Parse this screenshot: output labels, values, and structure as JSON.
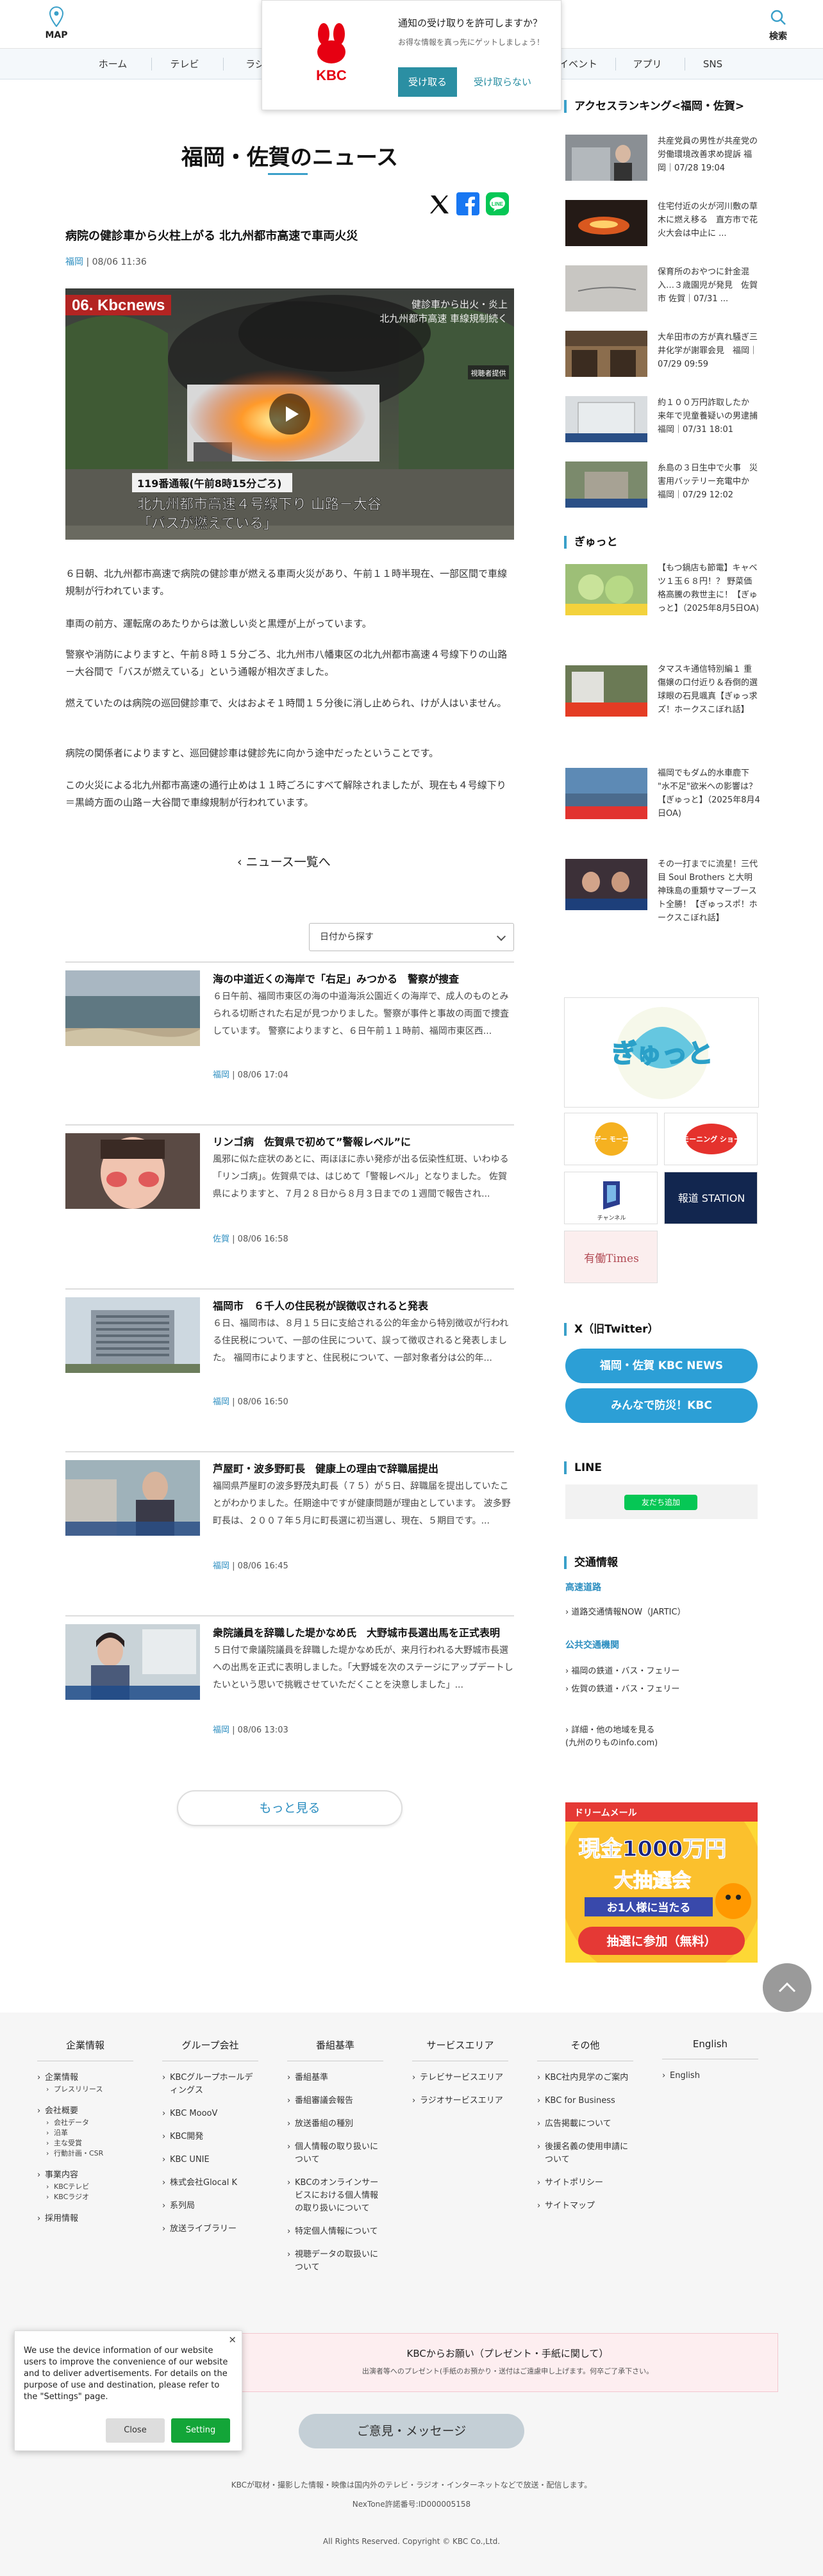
{
  "header": {
    "map_label": "MAP",
    "search_label": "検索"
  },
  "nav": {
    "items": [
      "ホーム",
      "テレビ",
      "ラジ",
      "イベント",
      "アプリ",
      "SNS"
    ]
  },
  "notification": {
    "logo_text": "KBC",
    "title": "通知の受け取りを許可しますか？",
    "subtitle": "お得な情報を真っ先にゲットしましょう！",
    "accept": "受け取る",
    "decline": "受け取らない"
  },
  "page": {
    "title": "福岡・佐賀のニュース"
  },
  "article": {
    "title": "病院の健診車から火柱上がる 北九州都市高速で車両火災",
    "category": "福岡",
    "date": "08/06 11:36",
    "video": {
      "logo": "06. Kbcnews",
      "topright1": "健診車から出火・炎上",
      "topright2": "北九州都市高速 車線規制続く",
      "badge": "視聴者提供",
      "caption_top": "119番通報(午前8時15分ごろ)",
      "caption_line1": "北九州都市高速４号線下り 山路－大谷",
      "caption_line2": "「バスが燃えている」"
    },
    "paragraphs": [
      "６日朝、北九州都市高速で病院の健診車が燃える車両火災があり、午前１１時半現在、一部区間で車線規制が行われています。",
      "車両の前方、運転席のあたりからは激しい炎と黒煙が上がっています。",
      "警察や消防によりますと、午前８時１５分ごろ、北九州市八幡東区の北九州都市高速４号線下りの山路－大谷間で「バスが燃えている」という通報が相次ぎました。",
      "燃えていたのは病院の巡回健診車で、火はおよそ１時間１５分後に消し止められ、けが人はいません。",
      "病院の関係者によりますと、巡回健診車は健診先に向かう途中だったということです。",
      "この火災による北九州都市高速の通行止めは１１時ごろにすべて解除されましたが、現在も４号線下り＝黒崎方面の山路－大谷間で車線規制が行われています。"
    ]
  },
  "back_link": "ニュース一覧へ",
  "sort": {
    "selected": "日付から探す"
  },
  "news": [
    {
      "title": "海の中道近くの海岸で「右足」みつかる　警察が捜査",
      "body": "６日午前、福岡市東区の海の中道海浜公園近くの海岸で、成人のものとみられる切断された右足が見つかりました。警察が事件と事故の両面で捜査しています。 警察によりますと、６日午前１１時前、福岡市東区西...",
      "category": "福岡",
      "date": "08/06 17:04"
    },
    {
      "title": "リンゴ病　佐賀県で初めて”警報レベル”に",
      "body": "風邪に似た症状のあとに、両ほほに赤い発疹が出る伝染性紅斑、いわゆる「リンゴ病」。佐賀県では、はじめて「警報レベル」となりました。 佐賀県によりますと、７月２８日から８月３日までの１週間で報告され...",
      "category": "佐賀",
      "date": "08/06 16:58"
    },
    {
      "title": "福岡市　６千人の住民税が誤徴収されると発表",
      "body": "６日、福岡市は、８月１５日に支給される公的年金から特別徴収が行われる住民税について、一部の住民について、誤って徴収されると発表しました。 福岡市によりますと、住民税について、一部対象者分は公的年...",
      "category": "福岡",
      "date": "08/06 16:50"
    },
    {
      "title": "芦屋町・波多野町長　健康上の理由で辞職届提出",
      "body": "福岡県芦屋町の波多野茂丸町長（７５）が５日、辞職届を提出していたことがわかりました。任期途中ですが健康問題が理由としています。 波多野町長は、２００７年５月に町長選に初当選し、現在、５期目です。...",
      "category": "福岡",
      "date": "08/06 16:45"
    },
    {
      "title": "衆院議員を辞職した堤かなめ氏　大野城市長選出馬を正式表明",
      "body": "５日付で衆議院議員を辞職した堤かなめ氏が、来月行われる大野城市長選への出馬を正式に表明しました。「大野城を次のステージにアップデートしたいという思いで挑戦させていただくことを決意しました」...",
      "category": "福岡",
      "date": "08/06 13:03"
    }
  ],
  "more_label": "もっと見る",
  "sidebar": {
    "ranking_title": "アクセスランキング<福岡・佐賀>",
    "ranking": [
      {
        "text": "共産党員の男性が共産党の労働環境改善求め提訴 福岡｜07/28 19:04"
      },
      {
        "text": "住宅付近の火が河川敷の草木に燃え移る　直方市で花火大会は中止に ..."
      },
      {
        "text": "保育所のおやつに針金混入…３歳園児が発見　佐賀市 佐賀｜07/31 ..."
      },
      {
        "text": "大牟田市の方が真れ騒ぎ三井化学が謝罪会見　福岡｜07/29 09:59"
      },
      {
        "text": "約１００万円詐取したか　来年で児童養疑いの男逮捕 福岡｜07/31 18:01"
      },
      {
        "text": "糸島の３日生中で火事　災害用バッテリー充電中か 福岡｜07/29 12:02"
      }
    ],
    "gyutto_title": "ぎゅっと",
    "gyutto": [
      {
        "text": "【もつ鍋店も節電】キャベツ１玉６８円！？ 野菜価格高騰の救世主に！【ぎゅっと】（2025年8月5日OA)"
      },
      {
        "text": "タマスキ通信特別編１ 重傷嬢の口付近り＆呑倒的選球眼の石見颯真【ぎゅっ求ズ！ホークスこぼれ話】"
      },
      {
        "text": "福岡でもダム的水車鹿下 \"水不足\"欲米への影響は？【ぎゅっと】（2025年8月4日OA)"
      },
      {
        "text": "その一打までに流星！三代目 Soul Brothers と大明神珠島の重類サマーブースト全勝！【ぎゅっスポ！ホークスこぼれ話】"
      }
    ],
    "banners": {
      "gyutto_logo": "ぎゅっと",
      "sunday": "サンデー モーニング",
      "morning": "モーニング ショー",
      "channel": "チャンネル",
      "hodo": "報道 STATION",
      "yuhan": "有働Times"
    },
    "twitter_title": "X（旧Twitter）",
    "twitter_buttons": [
      "福岡・佐賀 KBC NEWS",
      "みんなで防災！KBC"
    ],
    "line_title": "LINE",
    "line_button": "友だち追加",
    "traffic_title": "交通情報",
    "traffic_sub1": "高速道路",
    "traffic_link1": "道路交通情報NOW（JARTIC）",
    "traffic_sub2": "公共交通機関",
    "traffic_link2": "福岡の鉄道・バス・フェリー",
    "traffic_link3": "佐賀の鉄道・バス・フェリー",
    "traffic_link4": "詳細・他の地域を見る\n(九州のりものinfo.com)",
    "lotto": {
      "top": "ドリームメール",
      "l1": "現金1000万円",
      "l2": "大抽選会",
      "l3": "お1人様に当たる",
      "btn": "抽選に参加（無料）"
    }
  },
  "footer": {
    "cols": [
      {
        "head": "企業情報",
        "links": [
          {
            "t": "企業情報",
            "subs": [
              "プレスリリース"
            ]
          },
          {
            "t": "会社概要",
            "subs": [
              "会社データ",
              "沿革",
              "主な受賞",
              "行動計画・CSR"
            ]
          },
          {
            "t": "事業内容",
            "subs": [
              "KBCテレビ",
              "KBCラジオ"
            ]
          },
          {
            "t": "採用情報",
            "subs": []
          }
        ]
      },
      {
        "head": "グループ会社",
        "links": [
          {
            "t": "KBCグループホールディングス",
            "subs": []
          },
          {
            "t": "KBC MoooV",
            "subs": []
          },
          {
            "t": "KBC開発",
            "subs": []
          },
          {
            "t": "KBC UNIE",
            "subs": []
          },
          {
            "t": "株式会社Glocal K",
            "subs": []
          },
          {
            "t": "系列局",
            "subs": []
          },
          {
            "t": "放送ライブラリー",
            "subs": []
          }
        ]
      },
      {
        "head": "番組基準",
        "links": [
          {
            "t": "番組基準",
            "subs": []
          },
          {
            "t": "番組審議会報告",
            "subs": []
          },
          {
            "t": "放送番組の種別",
            "subs": []
          },
          {
            "t": "個人情報の取り扱いについて",
            "subs": []
          },
          {
            "t": "KBCのオンラインサービスにおける個人情報の取り扱いについて",
            "subs": []
          },
          {
            "t": "特定個人情報について",
            "subs": []
          },
          {
            "t": "視聴データの取扱いについて",
            "subs": []
          }
        ]
      },
      {
        "head": "サービスエリア",
        "links": [
          {
            "t": "テレビサービスエリア",
            "subs": []
          },
          {
            "t": "ラジオサービスエリア",
            "subs": []
          }
        ]
      },
      {
        "head": "その他",
        "links": [
          {
            "t": "KBC社内見学のご案内",
            "subs": []
          },
          {
            "t": "KBC for Business",
            "subs": []
          },
          {
            "t": "広告掲載について",
            "subs": []
          },
          {
            "t": "後援名義の使用申請について",
            "subs": []
          },
          {
            "t": "サイトポリシー",
            "subs": []
          },
          {
            "t": "サイトマップ",
            "subs": []
          }
        ]
      },
      {
        "head": "English",
        "links": [
          {
            "t": "English",
            "subs": []
          }
        ]
      }
    ],
    "present_title": "KBCからお願い（プレゼント・手紙に関して）",
    "present_sub": "出演者等へのプレゼント(手紙のお預かり・送付はご遠慮申し上げます。何卒ご了承下さい。",
    "opinion": "ご意見・メッセージ",
    "note1": "KBCが取材・撮影した情報・映像は国内外のテレビ・ラジオ・インターネットなどで放送・配信します。",
    "note2": "NexTone許諾番号:ID000005158",
    "copyright": "All Rights Reserved. Copyright © KBC Co.,Ltd."
  },
  "cookie": {
    "text": "We use the device information of our website users to improve the convenience of our website and to deliver advertisements. For details on the purpose of use and destination, please refer to the \"Settings\" page.",
    "close": "Close",
    "setting": "Setting"
  },
  "colors": {
    "accent": "#3aa0c9",
    "link": "#2c8ec0",
    "twitter": "#2c9fd6",
    "line": "#06c755",
    "kbc_red": "#e60012"
  }
}
